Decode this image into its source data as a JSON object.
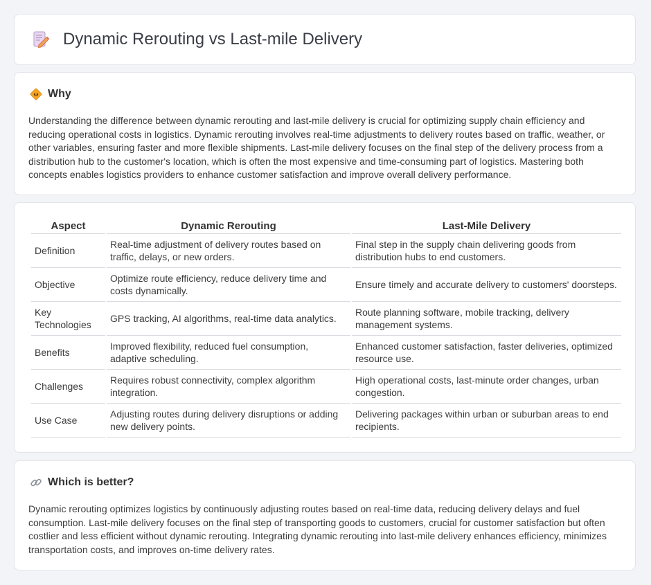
{
  "header": {
    "title": "Dynamic Rerouting vs Last-mile Delivery",
    "icon": "document-pencil-icon"
  },
  "why": {
    "icon": "diamond-sign-icon",
    "title": "Why",
    "text": "Understanding the difference between dynamic rerouting and last-mile delivery is crucial for optimizing supply chain efficiency and reducing operational costs in logistics. Dynamic rerouting involves real-time adjustments to delivery routes based on traffic, weather, or other variables, ensuring faster and more flexible shipments. Last-mile delivery focuses on the final step of the delivery process from a distribution hub to the customer's location, which is often the most expensive and time-consuming part of logistics. Mastering both concepts enables logistics providers to enhance customer satisfaction and improve overall delivery performance."
  },
  "comparison": {
    "headers": [
      "Aspect",
      "Dynamic Rerouting",
      "Last-Mile Delivery"
    ],
    "rows": [
      {
        "aspect": "Definition",
        "dynamic": "Real-time adjustment of delivery routes based on traffic, delays, or new orders.",
        "lastmile": "Final step in the supply chain delivering goods from distribution hubs to end customers."
      },
      {
        "aspect": "Objective",
        "dynamic": "Optimize route efficiency, reduce delivery time and costs dynamically.",
        "lastmile": "Ensure timely and accurate delivery to customers' doorsteps."
      },
      {
        "aspect": "Key Technologies",
        "dynamic": "GPS tracking, AI algorithms, real-time data analytics.",
        "lastmile": "Route planning software, mobile tracking, delivery management systems."
      },
      {
        "aspect": "Benefits",
        "dynamic": "Improved flexibility, reduced fuel consumption, adaptive scheduling.",
        "lastmile": "Enhanced customer satisfaction, faster deliveries, optimized resource use."
      },
      {
        "aspect": "Challenges",
        "dynamic": "Requires robust connectivity, complex algorithm integration.",
        "lastmile": "High operational costs, last-minute order changes, urban congestion."
      },
      {
        "aspect": "Use Case",
        "dynamic": "Adjusting routes during delivery disruptions or adding new delivery points.",
        "lastmile": "Delivering packages within urban or suburban areas to end recipients."
      }
    ]
  },
  "better": {
    "icon": "link-icon",
    "title": "Which is better?",
    "text": "Dynamic rerouting optimizes logistics by continuously adjusting routes based on real-time data, reducing delivery delays and fuel consumption. Last-mile delivery focuses on the final step of transporting goods to customers, crucial for customer satisfaction but often costlier and less efficient without dynamic rerouting. Integrating dynamic rerouting into last-mile delivery enhances efficiency, minimizes transportation costs, and improves on-time delivery rates."
  },
  "colors": {
    "background": "#f3f4f8",
    "card": "#ffffff",
    "border": "#e2e4ea",
    "accent_orange": "#f5a623"
  }
}
